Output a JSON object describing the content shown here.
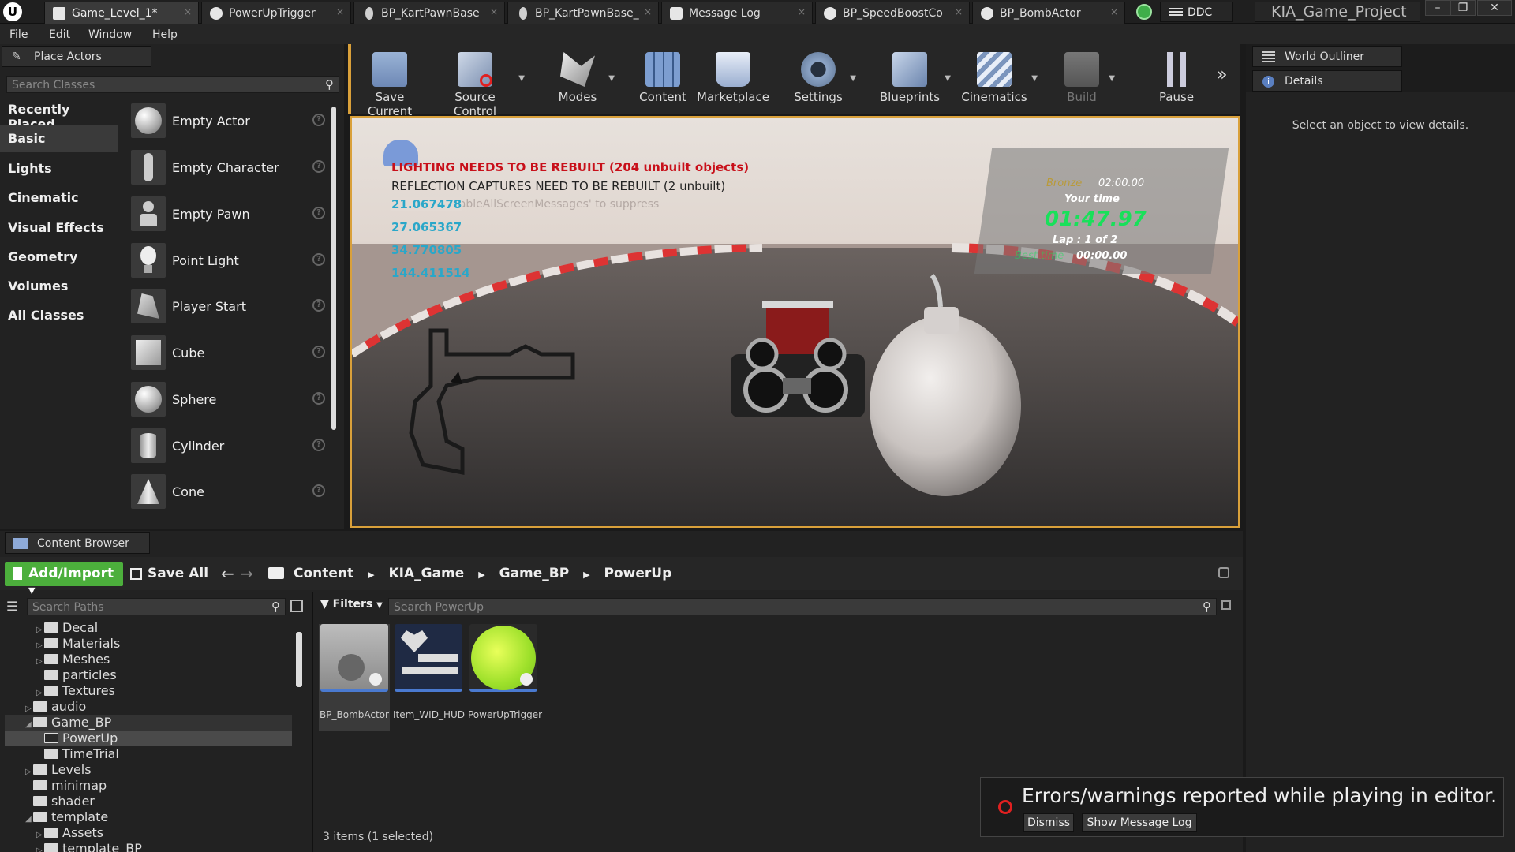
{
  "titlebar": {
    "tabs": [
      {
        "label": "Game_Level_1*"
      },
      {
        "label": "PowerUpTrigger"
      },
      {
        "label": "BP_KartPawnBase"
      },
      {
        "label": "BP_KartPawnBase_"
      },
      {
        "label": "Message Log"
      },
      {
        "label": "BP_SpeedBoostCo"
      },
      {
        "label": "BP_BombActor"
      }
    ],
    "ddc": "DDC",
    "project": "KIA_Game_Project"
  },
  "menu": [
    "File",
    "Edit",
    "Window",
    "Help"
  ],
  "place_actors": {
    "title": "Place Actors",
    "search_placeholder": "Search Classes",
    "categories": [
      "Recently Placed",
      "Basic",
      "Lights",
      "Cinematic",
      "Visual Effects",
      "Geometry",
      "Volumes",
      "All Classes"
    ],
    "selected_category": "Basic",
    "items": [
      "Empty Actor",
      "Empty Character",
      "Empty Pawn",
      "Point Light",
      "Player Start",
      "Cube",
      "Sphere",
      "Cylinder",
      "Cone"
    ]
  },
  "toolbar": [
    "Save Current",
    "Source Control",
    "Modes",
    "Content",
    "Marketplace",
    "Settings",
    "Blueprints",
    "Cinematics",
    "Build",
    "Pause"
  ],
  "viewport": {
    "warn1": "LIGHTING NEEDS TO BE REBUILT (204 unbuilt objects)",
    "warn2": "REFLECTION CAPTURES NEED TO BE REBUILT (2 unbuilt)",
    "suppress_hint": "'DisableAllScreenMessages' to suppress",
    "debug_values": [
      "21.067478",
      "27.065367",
      "34.770805",
      "144.411514"
    ],
    "hud": {
      "bronze_label": "Bronze",
      "bronze_time": "02:00.00",
      "your_time_label": "Your time",
      "your_time": "01:47.97",
      "lap": "Lap  : 1 of 2",
      "best_label": "Best time",
      "best_time": "00:00.00"
    }
  },
  "right_panel": {
    "world_outliner": "World Outliner",
    "details": "Details",
    "details_hint": "Select an object to view details."
  },
  "content_browser": {
    "title": "Content Browser",
    "add_import": "Add/Import",
    "save_all": "Save All",
    "breadcrumb": [
      "Content",
      "KIA_Game",
      "Game_BP",
      "PowerUp"
    ],
    "search_paths_placeholder": "Search Paths",
    "filters": "Filters",
    "search_assets_placeholder": "Search PowerUp",
    "tree": [
      {
        "label": "Decal"
      },
      {
        "label": "Materials"
      },
      {
        "label": "Meshes"
      },
      {
        "label": "particles"
      },
      {
        "label": "Textures"
      },
      {
        "label": "audio"
      },
      {
        "label": "Game_BP"
      },
      {
        "label": "PowerUp"
      },
      {
        "label": "TimeTrial"
      },
      {
        "label": "Levels"
      },
      {
        "label": "minimap"
      },
      {
        "label": "shader"
      },
      {
        "label": "template"
      },
      {
        "label": "Assets"
      },
      {
        "label": "template_BP"
      }
    ],
    "assets": [
      "BP_BombActor",
      "Item_WID_HUD",
      "PowerUpTrigger"
    ],
    "status": "3 items (1 selected)"
  },
  "toast": {
    "message": "Errors/warnings reported while playing in editor.",
    "dismiss": "Dismiss",
    "show_log": "Show Message Log"
  },
  "colors": {
    "accent_green": "#4caf3c",
    "viewport_border": "#d9a03a",
    "error_red": "#e02020",
    "hud_green": "#19e05a",
    "warn_red": "#c8101a",
    "debug_cyan": "#2aa7c9"
  }
}
